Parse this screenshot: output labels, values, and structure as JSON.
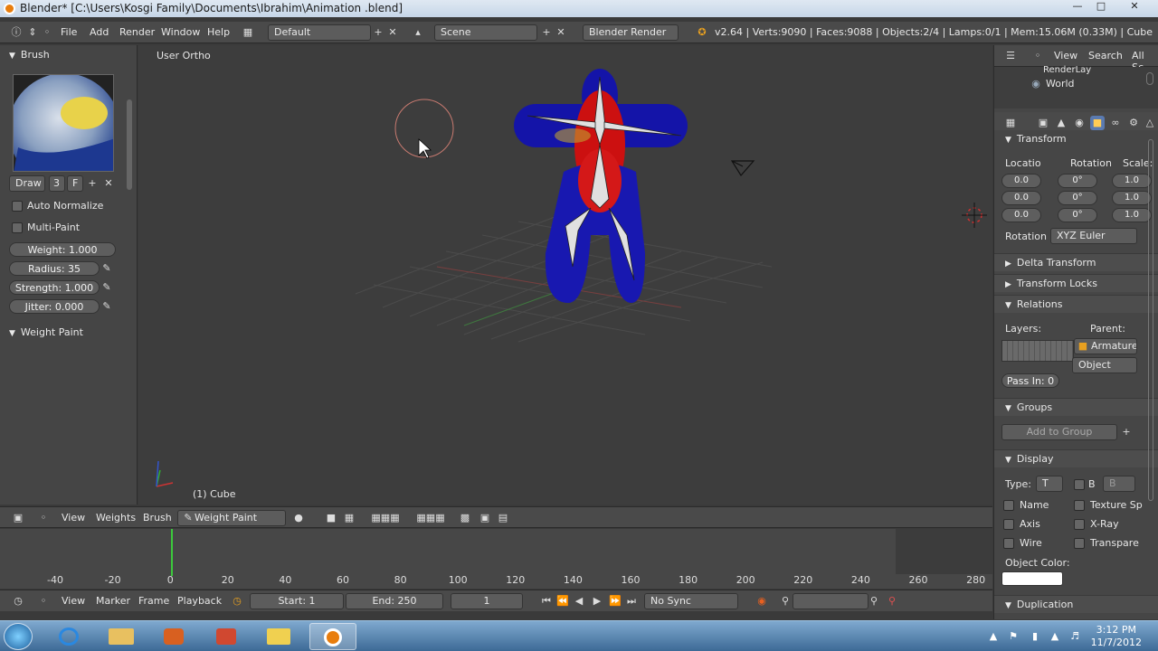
{
  "window": {
    "title": "Blender* [C:\\Users\\Kosgi Family\\Documents\\Ibrahim\\Animation .blend]"
  },
  "info_header": {
    "menus": [
      "File",
      "Add",
      "Render",
      "Window",
      "Help"
    ],
    "screen_layout": "Default",
    "scene": "Scene",
    "render_engine": "Blender Render",
    "stats": "v2.64 | Verts:9090 | Faces:9088 | Objects:2/4 | Lamps:0/1 | Mem:15.06M (0.33M) | Cube"
  },
  "tool_shelf": {
    "brush_panel_title": "Brush",
    "brush_name": "Draw",
    "brush_users": "3",
    "brush_fake_user": "F",
    "auto_normalize_label": "Auto Normalize",
    "multi_paint_label": "Multi-Paint",
    "weight": "Weight: 1.000",
    "radius": "Radius: 35",
    "strength": "Strength: 1.000",
    "jitter": "Jitter: 0.000",
    "weight_paint_panel_title": "Weight Paint"
  },
  "viewport": {
    "view_label": "User Ortho",
    "object_label": "(1) Cube"
  },
  "viewport_header": {
    "menus": [
      "View",
      "Weights",
      "Brush"
    ],
    "mode": "Weight Paint"
  },
  "outliner": {
    "view_menu": "View",
    "search_menu": "Search",
    "filter": "All Sc",
    "items": [
      "RenderLay",
      "World"
    ]
  },
  "properties": {
    "transform_title": "Transform",
    "location_label": "Locatio",
    "rotation_label": "Rotation",
    "scale_label": "Scale:",
    "location_values": [
      "0.0",
      "0.0",
      "0.0"
    ],
    "rotation_values": [
      "0°",
      "0°",
      "0°"
    ],
    "scale_values": [
      "1.0",
      "1.0",
      "1.0"
    ],
    "rotation_mode_label": "Rotation",
    "rotation_mode": "XYZ Euler",
    "delta_transform_title": "Delta Transform",
    "transform_locks_title": "Transform Locks",
    "relations_title": "Relations",
    "layers_label": "Layers:",
    "parent_label": "Parent:",
    "parent_value": "Armature",
    "parent_type": "Object",
    "pass_index": "Pass In: 0",
    "groups_title": "Groups",
    "add_to_group": "Add to Group",
    "display_title": "Display",
    "type_label": "Type:",
    "type_value": "T",
    "bounds_label": "B",
    "bounds_value": "B",
    "name_label": "Name",
    "texture_space_label": "Texture Sp",
    "axis_label": "Axis",
    "xray_label": "X-Ray",
    "wire_label": "Wire",
    "transparent_label": "Transpare",
    "object_color_label": "Object Color:",
    "object_color": "#ffffff",
    "duplication_title": "Duplication"
  },
  "timeline": {
    "ticks": [
      "-40",
      "-20",
      "0",
      "20",
      "40",
      "60",
      "80",
      "100",
      "120",
      "140",
      "160",
      "180",
      "200",
      "220",
      "240",
      "260",
      "280"
    ],
    "current_frame_marker": "0"
  },
  "timeline_header": {
    "menus": [
      "View",
      "Marker",
      "Frame",
      "Playback"
    ],
    "start": "Start: 1",
    "end": "End: 250",
    "current_frame": "1",
    "sync": "No Sync"
  },
  "taskbar": {
    "time": "3:12 PM",
    "date": "11/7/2012"
  },
  "colors": {
    "blender_bg": "#3d3d3d",
    "header_bg": "#4a4a4a",
    "accent_orange": "#e87d0d",
    "weight_blue": "#1a1aa0",
    "weight_red": "#e01010",
    "frame_marker": "#3cc93c"
  }
}
